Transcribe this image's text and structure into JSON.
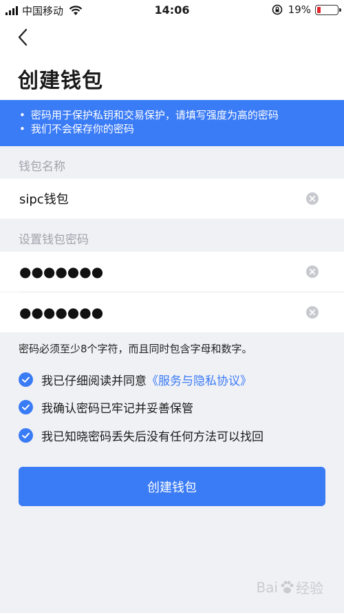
{
  "status_bar": {
    "carrier": "中国移动",
    "time": "14:06",
    "battery_percent": "19%",
    "battery_level": 0.19,
    "battery_color": "#e0252b"
  },
  "header": {
    "back_icon": "chevron-left-icon",
    "title": "创建钱包"
  },
  "notice": {
    "lines": [
      "密码用于保护私钥和交易保护，请填写强度为高的密码",
      "我们不会保存你的密码"
    ],
    "background": "#3a7bf6"
  },
  "form": {
    "wallet_name_label": "钱包名称",
    "wallet_name_value": "sipc钱包",
    "password_label": "设置钱包密码",
    "password_value": "●●●●●●●",
    "confirm_password_value": "●●●●●●●",
    "clear_icon": "clear-circle-icon"
  },
  "hint": "密码必须至少8个字符，而且同时包含字母和数字。",
  "agreements": [
    {
      "text": "我已仔细阅读并同意",
      "link": "《服务与隐私协议》",
      "checked": true
    },
    {
      "text": "我确认密码已牢记并妥善保管",
      "checked": true
    },
    {
      "text": "我已知晓密码丢失后没有任何方法可以找回",
      "checked": true
    }
  ],
  "submit_label": "创建钱包",
  "watermark": {
    "brand_left": "Bai",
    "brand_right": "经验"
  },
  "accent_color": "#3a7bf6"
}
